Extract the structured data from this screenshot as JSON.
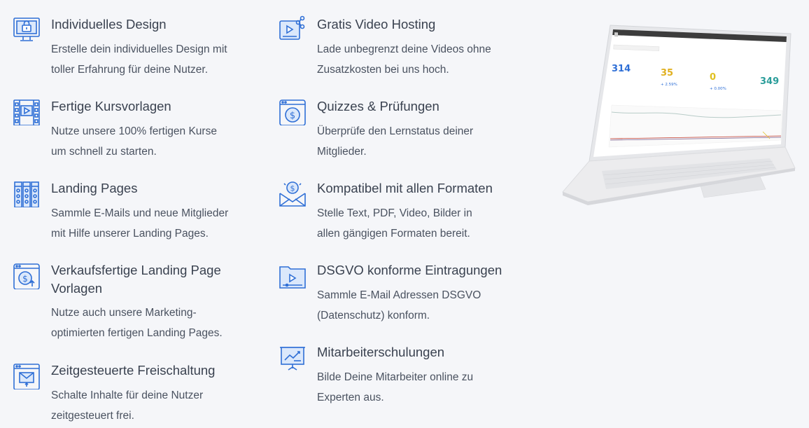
{
  "features_left": [
    {
      "icon": "design-monitor-icon",
      "title": "Individuelles Design",
      "desc_line1": "Erstelle dein individuelles Design mit",
      "desc_line2": "toller Erfahrung für deine Nutzer."
    },
    {
      "icon": "film-template-icon",
      "title": "Fertige Kursvorlagen",
      "desc_line1": "Nutze unsere 100% fertigen Kurse",
      "desc_line2": "um schnell zu starten."
    },
    {
      "icon": "landing-pages-icon",
      "title": "Landing Pages",
      "desc_line1": "Sammle E-Mails und neue Mitglieder",
      "desc_line2": "mit Hilfe unserer Landing Pages."
    },
    {
      "icon": "dollar-upload-icon",
      "title_line1": "Verkaufsfertige Landing Page",
      "title_line2": "Vorlagen",
      "desc_line1": "Nutze auch unsere Marketing-",
      "desc_line2": "optimierten fertigen Landing Pages."
    },
    {
      "icon": "timed-mail-icon",
      "title": "Zeitgesteuerte Freischaltung",
      "desc_line1": "Schalte Inhalte für deine Nutzer",
      "desc_line2": "zeitgesteuert frei."
    }
  ],
  "features_mid": [
    {
      "icon": "video-share-icon",
      "title": "Gratis Video Hosting",
      "desc_line1": "Lade unbegrenzt deine Videos ohne",
      "desc_line2": "Zusatzkosten bei uns hoch."
    },
    {
      "icon": "dollar-window-icon",
      "title": "Quizzes & Prüfungen",
      "desc_line1": "Überprüfe den Lernstatus deiner",
      "desc_line2": "Mitglieder."
    },
    {
      "icon": "dollar-envelope-icon",
      "title": "Kompatibel mit allen Formaten",
      "desc_line1": "Stelle Text, PDF, Video, Bilder in",
      "desc_line2": "allen gängigen Formaten bereit."
    },
    {
      "icon": "video-folder-icon",
      "title": "DSGVO konforme Eintragungen",
      "desc_line1": "Sammle E-Mail Adressen DSGVO",
      "desc_line2": "(Datenschutz) konform."
    },
    {
      "icon": "presentation-board-icon",
      "title": "Mitarbeiterschulungen",
      "desc_line1": "Bilde Deine Mitarbeiter online zu",
      "desc_line2": "Experten aus."
    }
  ],
  "laptop_dashboard": {
    "stat1_value": "314",
    "stat2_value": "35",
    "stat2_change": "+ 2.59%",
    "stat3_value": "0",
    "stat3_change": "+ 0.00%",
    "stat4_value": "349"
  },
  "colors": {
    "icon_blue": "#2f6fd6",
    "bg": "#f5f6f9",
    "text": "#3b4451"
  }
}
